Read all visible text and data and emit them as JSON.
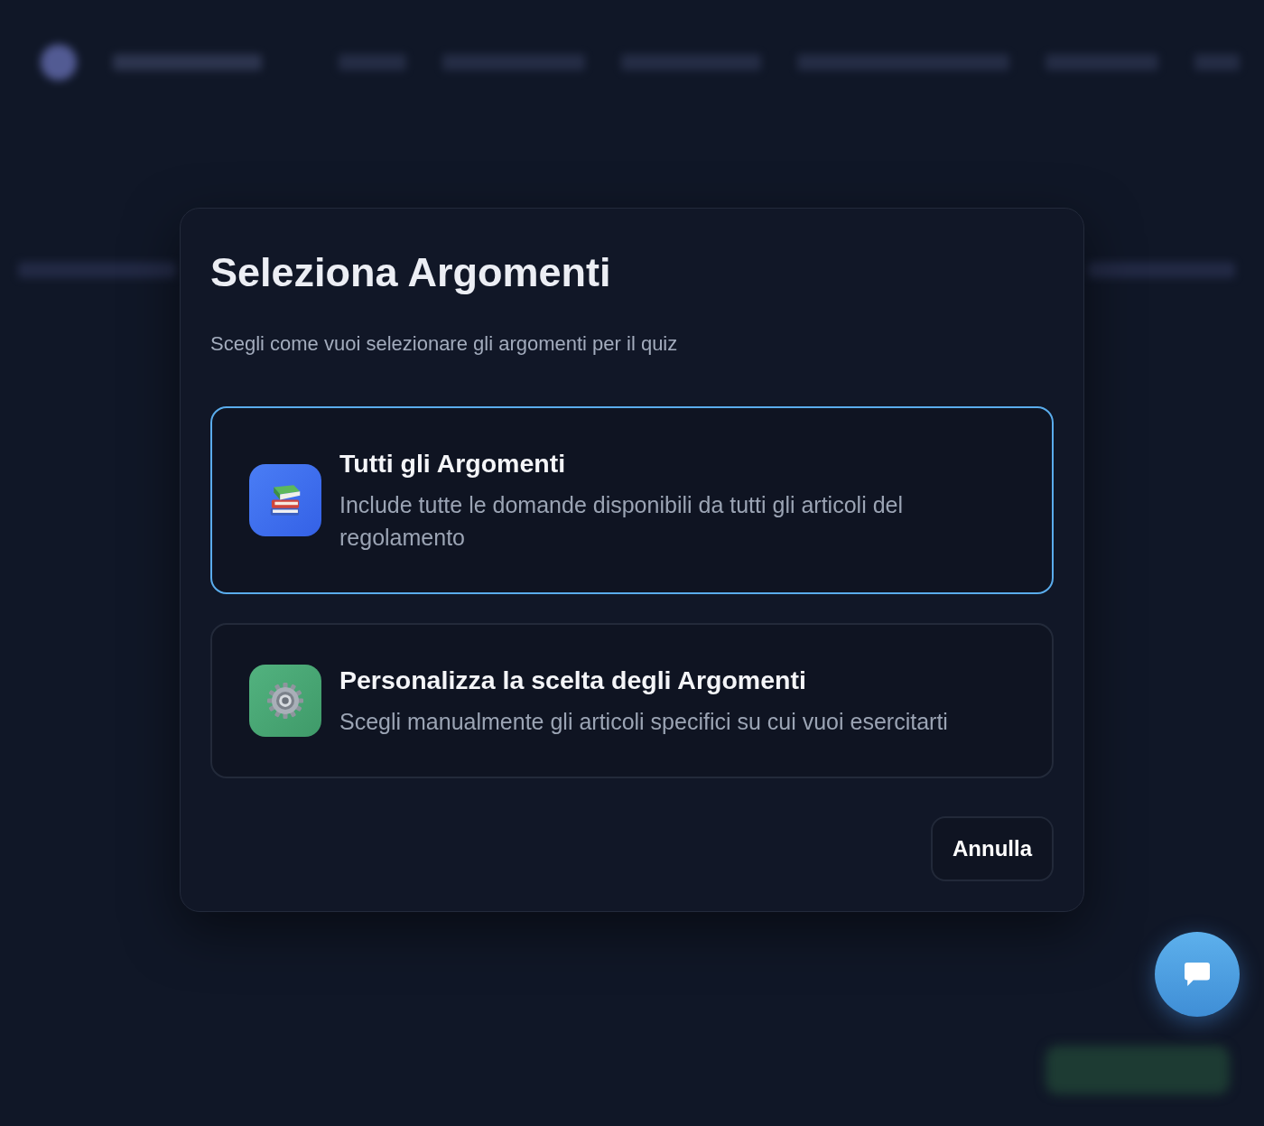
{
  "dialog": {
    "title": "Seleziona Argomenti",
    "subtitle": "Scegli come vuoi selezionare gli argomenti per il quiz",
    "options": [
      {
        "kind": "all",
        "title": "Tutti gli Argomenti",
        "description": "Include tutte le domande disponibili da tutti gli articoli del regolamento",
        "selected": true
      },
      {
        "kind": "custom",
        "title": "Personalizza la scelta degli Argomenti",
        "description": "Scegli manualmente gli articoli specifici su cui vuoi esercitarti",
        "selected": false
      }
    ],
    "buttons": [
      "Annulla"
    ]
  }
}
